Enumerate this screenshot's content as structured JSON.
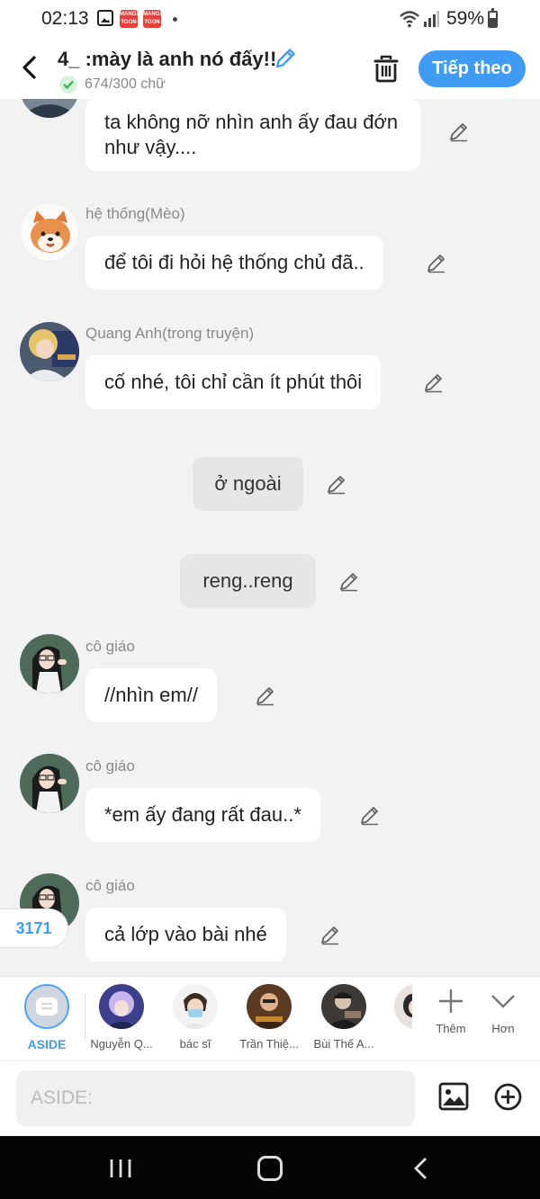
{
  "status_bar": {
    "time": "02:13",
    "battery": "59%",
    "notif_badge": "MANGA TOON"
  },
  "header": {
    "title": "4_ :mày là anh nó đấy!!",
    "word_count": "674/300 chữ",
    "next_label": "Tiếp theo"
  },
  "messages": [
    {
      "type": "bubble",
      "sender": "",
      "text": "ta không nỡ nhìn anh ấy đau đớn như vậy...."
    },
    {
      "type": "bubble",
      "sender": "hệ thống(Mèo)",
      "text": "để tôi đi hỏi hệ thống chủ đã.."
    },
    {
      "type": "bubble",
      "sender": "Quang Anh(trong truyện)",
      "text": "cố nhé, tôi chỉ cần ít phút thôi"
    },
    {
      "type": "narration",
      "text": "ở ngoài"
    },
    {
      "type": "narration",
      "text": "reng..reng"
    },
    {
      "type": "bubble",
      "sender": "cô giáo",
      "text": "//nhìn em//"
    },
    {
      "type": "bubble",
      "sender": "cô giáo",
      "text": "*em ấy đang rất đau..*"
    },
    {
      "type": "bubble",
      "sender": "cô giáo",
      "text": "cả lớp vào bài nhé"
    }
  ],
  "count_badge": "3171",
  "characters": [
    {
      "name": "ASIDE"
    },
    {
      "name": "Nguyễn Q..."
    },
    {
      "name": "bác sĩ"
    },
    {
      "name": "Trần Thiệ..."
    },
    {
      "name": "Bùi Thế A..."
    },
    {
      "name": ""
    }
  ],
  "actions": {
    "add_label": "Thêm",
    "more_label": "Hơn"
  },
  "input": {
    "placeholder": "ASIDE:"
  },
  "colors": {
    "accent": "#3f9bf3",
    "background": "#f2f2f2",
    "bubble": "#ffffff",
    "narration": "#e6e6e6"
  },
  "icons": [
    "back-icon",
    "pencil-icon",
    "check-icon",
    "trash-icon",
    "image-icon",
    "add-circle-icon",
    "plus-icon",
    "chevron-down-icon"
  ]
}
